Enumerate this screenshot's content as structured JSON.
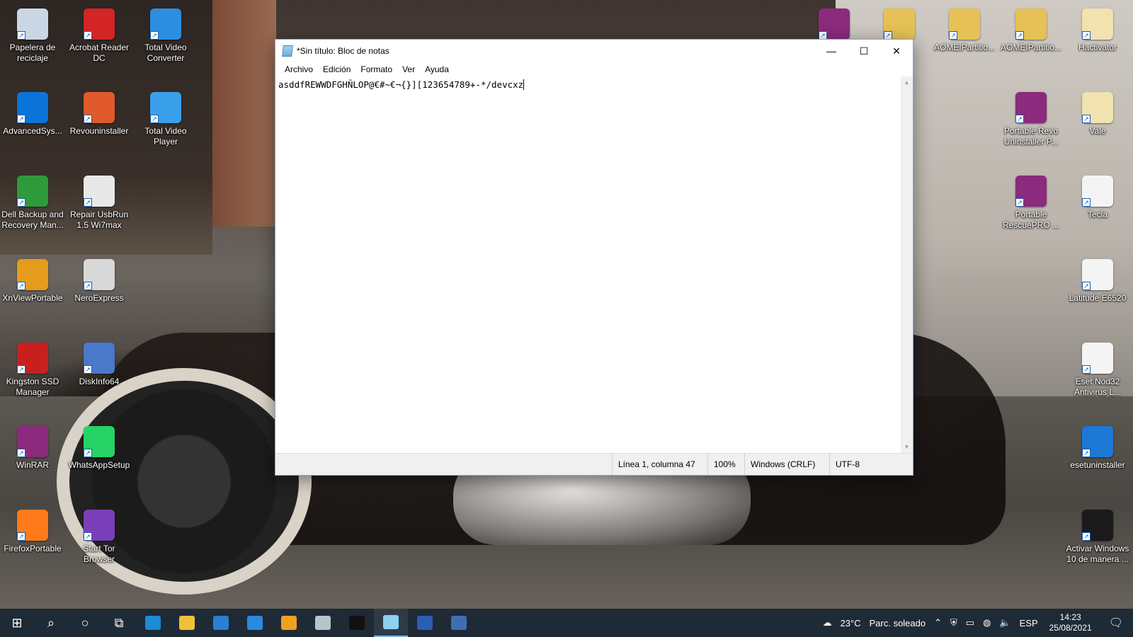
{
  "desktop_icons_left": [
    {
      "label": "Papelera de reciclaje",
      "icon": "recycle-bin-icon",
      "color": "#c9d6e4"
    },
    {
      "label": "Acrobat Reader DC",
      "icon": "acrobat-reader-icon",
      "color": "#d32525"
    },
    {
      "label": "Total Video Converter",
      "icon": "total-video-converter-icon",
      "color": "#2d8fe0"
    },
    {
      "label": "AdvancedSys...",
      "icon": "advancedsystemcare-icon",
      "color": "#0b74d8"
    },
    {
      "label": "Revouninstaller",
      "icon": "revo-uninstaller-icon",
      "color": "#e05a2b"
    },
    {
      "label": "Total Video Player",
      "icon": "total-video-player-icon",
      "color": "#3ba0ea"
    },
    {
      "label": "Dell Backup and Recovery Man...",
      "icon": "dell-backup-icon",
      "color": "#2e9b3a"
    },
    {
      "label": "Repair UsbRun 1.5 Wi7max",
      "icon": "usb-drive-icon",
      "color": "#e8e8e8"
    },
    {
      "label": "XnViewPortable",
      "icon": "xnview-icon",
      "color": "#e59b1c"
    },
    {
      "label": "NeroExpress",
      "icon": "nero-express-icon",
      "color": "#d8d8d8"
    },
    {
      "label": "Kingston SSD Manager",
      "icon": "kingston-icon",
      "color": "#c8201f"
    },
    {
      "label": "DiskInfo64",
      "icon": "diskinfo-icon",
      "color": "#4a79c9"
    },
    {
      "label": "WinRAR",
      "icon": "winrar-icon",
      "color": "#8c2a7d"
    },
    {
      "label": "WhatsAppSetup",
      "icon": "whatsapp-icon",
      "color": "#25d366"
    },
    {
      "label": "FirefoxPortable",
      "icon": "firefox-icon",
      "color": "#ff7a1a"
    },
    {
      "label": "Start Tor Browser",
      "icon": "tor-browser-icon",
      "color": "#7a3fb8"
    }
  ],
  "desktop_icons_right": [
    {
      "label": "",
      "icon": "winrar-archive-icon",
      "color": "#8c2a7d"
    },
    {
      "label": "",
      "icon": "folder-icon",
      "color": "#e6c156"
    },
    {
      "label": "AOMEIPartitio...",
      "icon": "folder-icon",
      "color": "#e6c156"
    },
    {
      "label": "AOMEIPartitio...",
      "icon": "folder-icon",
      "color": "#e6c156"
    },
    {
      "label": "Hactivator",
      "icon": "folder-icon",
      "color": "#f0e3b0"
    },
    {
      "label": "Portable Revo Uninstaller P...",
      "icon": "winrar-archive-icon",
      "color": "#8c2a7d"
    },
    {
      "label": "Vale",
      "icon": "folder-icon",
      "color": "#f0e3b0"
    },
    {
      "label": "Portable RescuePRO ...",
      "icon": "winrar-archive-icon",
      "color": "#8c2a7d"
    },
    {
      "label": "Tecla",
      "icon": "text-document-icon",
      "color": "#f4f4f4"
    },
    {
      "label": "Latitude E6520",
      "icon": "text-document-icon",
      "color": "#f4f4f4"
    },
    {
      "label": "Eset Nod32 Antivirus L...",
      "icon": "text-document-icon",
      "color": "#f4f4f4"
    },
    {
      "label": "esetuninstaller",
      "icon": "application-icon",
      "color": "#1c78d4"
    },
    {
      "label": "Activar Windows 10 de manera ...",
      "icon": "video-thumbnail-icon",
      "color": "#1a1a1a"
    }
  ],
  "notepad": {
    "title": "*Sin título: Bloc de notas",
    "menu": [
      "Archivo",
      "Edición",
      "Formato",
      "Ver",
      "Ayuda"
    ],
    "content": "asddfREWWDFGHÑLOP@€#~€¬{}][123654789+-*/devcxz",
    "status": {
      "position": "Línea 1, columna 47",
      "zoom": "100%",
      "line_ending": "Windows (CRLF)",
      "encoding": "UTF-8"
    },
    "controls": {
      "minimize": "—",
      "maximize": "☐",
      "close": "✕"
    }
  },
  "taskbar": {
    "weather_temp": "23°C",
    "weather_desc": "Parc. soleado",
    "lang": "ESP",
    "time": "14:23",
    "date": "25/08/2021",
    "items": [
      {
        "icon": "windows-start-icon",
        "glyph": "⊞"
      },
      {
        "icon": "search-icon",
        "glyph": "⌕"
      },
      {
        "icon": "cortana-icon",
        "glyph": "○"
      },
      {
        "icon": "task-view-icon",
        "glyph": "⧉"
      },
      {
        "icon": "edge-icon",
        "color": "#1e8ad6"
      },
      {
        "icon": "file-explorer-icon",
        "color": "#f2c038"
      },
      {
        "icon": "store-icon",
        "color": "#2a7fd4"
      },
      {
        "icon": "mail-icon",
        "color": "#2a8ae0"
      },
      {
        "icon": "media-player-icon",
        "color": "#f0a020"
      },
      {
        "icon": "photos-icon",
        "color": "#b8c4cc"
      },
      {
        "icon": "terminal-icon",
        "color": "#111111"
      },
      {
        "icon": "notepad-icon",
        "color": "#8fd0ef",
        "active": true
      },
      {
        "icon": "word-icon",
        "color": "#2b5fb3"
      },
      {
        "icon": "calculator-icon",
        "color": "#3d6fb0"
      }
    ]
  }
}
